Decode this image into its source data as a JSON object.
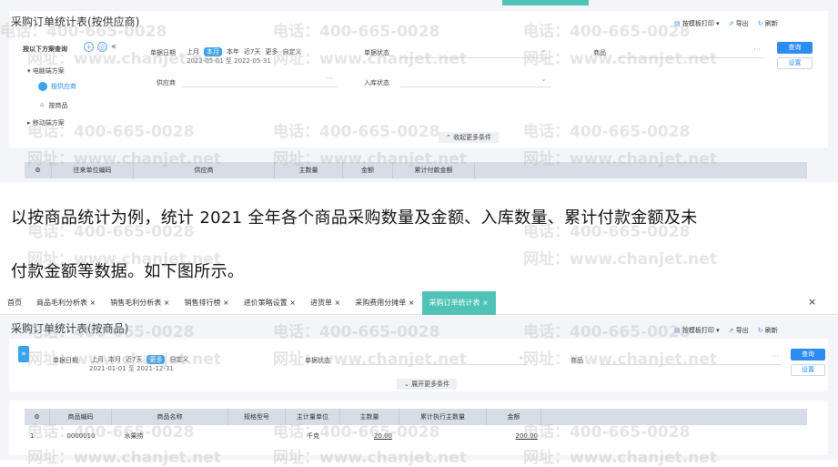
{
  "screen1": {
    "title": "采购订单统计表(按供应商)",
    "toolbar": {
      "print": "按模板打印",
      "export": "导出",
      "refresh": "刷新"
    },
    "sidebar": {
      "header": "按以下方案查询",
      "group1": "电脑端方案",
      "item_active": "按供应商",
      "item2": "按商品",
      "group2": "移动端方案"
    },
    "filters": {
      "date_label": "单据日期",
      "date_chips": [
        "上月",
        "本月",
        "本年",
        "近7天",
        "更多",
        "自定义"
      ],
      "date_range": "2022-05-01 至 2022-05-31",
      "status_label": "单据状态",
      "goods_label": "商品",
      "supplier_label": "供应商",
      "instock_label": "入库状态",
      "collapse": "收起更多条件"
    },
    "buttons": {
      "query": "查询",
      "settings": "设置"
    },
    "table_headers": [
      "往来单位编码",
      "供应商",
      "主数量",
      "金额",
      "累计付款金额"
    ]
  },
  "prose": {
    "line1": "以按商品统计为例，统计 2021 全年各个商品采购数量及金额、入库数量、累计付款金额及未",
    "line2": "付款金额等数据。如下图所示。"
  },
  "screen2": {
    "tabs": [
      "首页",
      "商品毛利分析表 ×",
      "销售毛利分析表 ×",
      "销售排行榜 ×",
      "进价策略设置 ×",
      "进货单 ×",
      "采购费用分摊单 ×",
      "采购订单统计表 ×"
    ],
    "close": "×",
    "title": "采购订单统计表(按商品)",
    "toolbar": {
      "print": "按模板打印",
      "export": "导出",
      "refresh": "刷新"
    },
    "filters": {
      "date_label": "单据日期",
      "date_chips": [
        "上月",
        "本月",
        "近7天",
        "更多",
        "自定义"
      ],
      "date_range": "2021-01-01 至 2021-12-31",
      "status_label": "单据状态",
      "goods_label": "商品",
      "expand": "展开更多条件"
    },
    "buttons": {
      "query": "查询",
      "settings": "设置"
    },
    "table_headers": [
      "商品编码",
      "商品名称",
      "规格型号",
      "主计量单位",
      "主数量",
      "累计执行主数量",
      "金额"
    ],
    "rows": [
      {
        "idx": "1",
        "code": "0000010",
        "name": "水果捞",
        "spec": "",
        "unit": "千克",
        "qty": "20.00",
        "exec": "",
        "amount": "200.00"
      }
    ]
  },
  "watermarks": {
    "phone": "电话：400-665-0028",
    "site": "网址：www.chanjet.net"
  }
}
